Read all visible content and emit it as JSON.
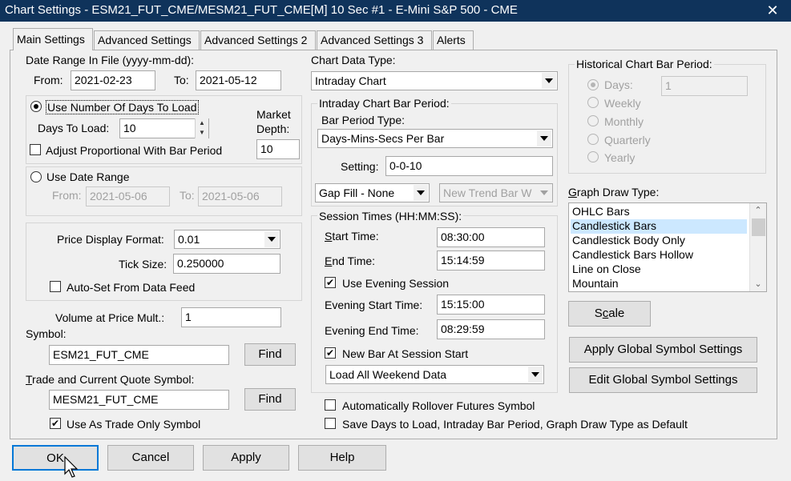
{
  "window": {
    "title": "Chart Settings - ESM21_FUT_CME/MESM21_FUT_CME[M]  10 Sec  #1 - E-Mini S&P 500 - CME",
    "close_glyph": "✕"
  },
  "tabs": [
    "Main Settings",
    "Advanced Settings",
    "Advanced Settings 2",
    "Advanced Settings 3",
    "Alerts"
  ],
  "date_range": {
    "label": "Date Range In File (yyyy-mm-dd):",
    "from_label": "From:",
    "from_value": "2021-02-23",
    "to_label": "To:",
    "to_value": "2021-05-12"
  },
  "days_to_load": {
    "radio_label": "Use Number Of Days To Load",
    "days_label": "Days To Load:",
    "days_value": "10",
    "adjust_label": "Adjust Proportional With Bar Period"
  },
  "market_depth": {
    "label_line1": "Market",
    "label_line2": "Depth:",
    "value": "10"
  },
  "date_range_use": {
    "radio_label": "Use Date Range",
    "from_label": "From:",
    "from_value": "2021-05-06",
    "to_label": "To:",
    "to_value": "2021-05-06"
  },
  "price": {
    "format_label": "Price Display Format:",
    "format_value": "0.01",
    "tick_label": "Tick Size:",
    "tick_value": "0.250000",
    "autoset_label": "Auto-Set From Data Feed"
  },
  "volume": {
    "label": "Volume at Price Mult.:",
    "value": "1"
  },
  "symbol": {
    "label": "Symbol:",
    "value": "ESM21_FUT_CME",
    "find": "Find"
  },
  "trade_symbol": {
    "label": "Trade and Current Quote Symbol:",
    "value": "MESM21_FUT_CME",
    "find": "Find",
    "trade_only_label": "Use As Trade Only Symbol"
  },
  "chart_data_type": {
    "label": "Chart Data Type:",
    "value": "Intraday Chart"
  },
  "intraday": {
    "group_label": "Intraday Chart Bar Period:",
    "bar_type_label": "Bar Period Type:",
    "bar_type_value": "Days-Mins-Secs Per Bar",
    "setting_label": "Setting:",
    "setting_value": "0-0-10",
    "gap_value": "Gap Fill - None",
    "new_trend_value": "New Trend Bar W"
  },
  "session": {
    "group_label": "Session Times (HH:MM:SS):",
    "start_label": "Start Time:",
    "start_value": "08:30:00",
    "end_label": "End Time:",
    "end_value": "15:14:59",
    "evening_label": "Use Evening Session",
    "eve_start_label": "Evening Start Time:",
    "eve_start_value": "15:15:00",
    "eve_end_label": "Evening End Time:",
    "eve_end_value": "08:29:59",
    "new_bar_label": "New Bar At Session Start",
    "weekend_value": "Load All Weekend Data"
  },
  "rollover_label": "Automatically Rollover Futures Symbol",
  "save_default_label": "Save Days to Load, Intraday Bar Period, Graph Draw Type as Default",
  "historical": {
    "group_label": "Historical Chart Bar Period:",
    "days": "Days:",
    "days_value": "1",
    "weekly": "Weekly",
    "monthly": "Monthly",
    "quarterly": "Quarterly",
    "yearly": "Yearly"
  },
  "graph_draw": {
    "label": "Graph Draw Type:",
    "items": [
      "OHLC Bars",
      "Candlestick Bars",
      "Candlestick Body Only",
      "Candlestick Bars Hollow",
      "Line on Close",
      "Mountain"
    ],
    "selected_index": 1
  },
  "buttons": {
    "scale": "Scale",
    "apply_global": "Apply Global Symbol Settings",
    "edit_global": "Edit Global Symbol Settings",
    "ok": "OK",
    "cancel": "Cancel",
    "apply": "Apply",
    "help": "Help"
  }
}
